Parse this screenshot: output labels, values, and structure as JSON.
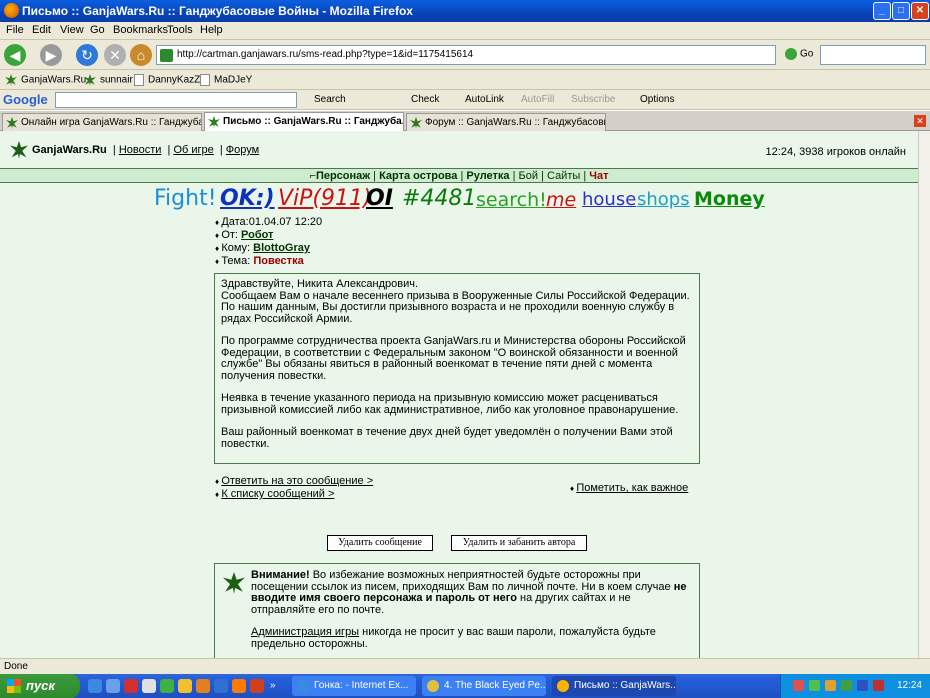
{
  "window": {
    "title": "Письмо :: GanjaWars.Ru :: Ганджубасовые Войны - Mozilla Firefox"
  },
  "menu": [
    "File",
    "Edit",
    "View",
    "Go",
    "Bookmarks",
    "Tools",
    "Help"
  ],
  "nav": {
    "url": "http://cartman.ganjawars.ru/sms-read.php?type=1&id=1175415614",
    "go_label": "Go"
  },
  "bookmarks": [
    "GanjaWars.Ru",
    "sunnair",
    "DannyKazZ",
    "MaDJeY"
  ],
  "google_toolbar": {
    "brand": "Google",
    "search_label": "Search",
    "check_label": "Check",
    "autolink_label": "AutoLink",
    "autofill_label": "AutoFill",
    "subscribe_label": "Subscribe",
    "options_label": "Options"
  },
  "tabs": [
    "Онлайн игра GanjaWars.Ru :: Ганджубас...",
    "Письмо :: GanjaWars.Ru :: Ганджуба...",
    "Форум :: GanjaWars.Ru :: Ганджубасовы..."
  ],
  "site": {
    "logo": "GanjaWars.Ru",
    "links": [
      "Новости",
      "Об игре",
      "Форум"
    ],
    "online": "12:24, 3938 игроков онлайн",
    "gamenav": [
      "Персонаж",
      "Карта острова",
      "Рулетка",
      "Бой",
      "Сайты",
      "Чат"
    ]
  },
  "logos": [
    {
      "text": "Fight!",
      "color": "#1a8fd8"
    },
    {
      "text": "OK:)",
      "color": "#1030c0"
    },
    {
      "text": "ViP(911)",
      "color": "#d01010"
    },
    {
      "text": "OI",
      "color": "#000000"
    },
    {
      "text": "#4481",
      "color": "#0a7a0a"
    },
    {
      "text": "search!",
      "color": "#2aa02a"
    },
    {
      "text": "me",
      "color": "#d01010"
    },
    {
      "text": "house",
      "color": "#3030c0"
    },
    {
      "text": "shops",
      "color": "#20a0c0"
    },
    {
      "text": "Money",
      "color": "#0a8a0a"
    }
  ],
  "message": {
    "date_label": "Дата:",
    "date": "01.04.07 12:20",
    "from_label": "От:",
    "from": "Робот",
    "to_label": "Кому:",
    "to": "BlottoGray",
    "subject_label": "Тема:",
    "subject": "Повестка",
    "body": [
      "Здравствуйте, Никита Александрович.\nСообщаем Вам о начале весеннего призыва в Вооруженные Силы Российской Федерации.\nПо нашим данным, Вы достигли призывного возраста и не проходили военную службу в рядах Российской Армии.",
      "По программе сотрудничества проекта GanjaWars.ru и Министерства обороны Российской Федерации, в соответствии с Федеральным законом \"О воинской обязанности и военной службе\" Вы обязаны явиться в районный военкомат в течение пяти дней с момента получения повестки.",
      "Неявка в течение указанного периода на призывную комиссию может расцениваться призывной комиссией либо как административное, либо как уголовное правонарушение.",
      "Ваш районный военкомат в течение двух дней будет уведомлён о получении Вами этой повестки."
    ]
  },
  "actions": {
    "reply": "Ответить на это сообщение >",
    "to_list": "К списку сообщений >",
    "mark_important": "Пометить, как важное"
  },
  "buttons": {
    "delete": "Удалить сообщение",
    "delete_ban": "Удалить и забанить автора"
  },
  "warning": {
    "title": "Внимание!",
    "text1": " Во избежание возможных неприятностей будьте осторожны при посещении ссылок из писем, приходящих Вам по личной почте. Ни в коем случае ",
    "bold": "не вводите имя своего персонажа и пароль от него",
    "text2": " на других сайтах и не отправляйте его по почте.",
    "admin_link": "Администрация игры",
    "text3": " никогда не просит у вас ваши пароли, пожалуйста будьте предельно осторожны."
  },
  "status": "Done",
  "taskbar": {
    "start": "пуск",
    "items": [
      "Гонка: - Internet Ex...",
      "4. The Black Eyed Pe...",
      "Письмо :: GanjaWars..."
    ],
    "clock": "12:24"
  }
}
